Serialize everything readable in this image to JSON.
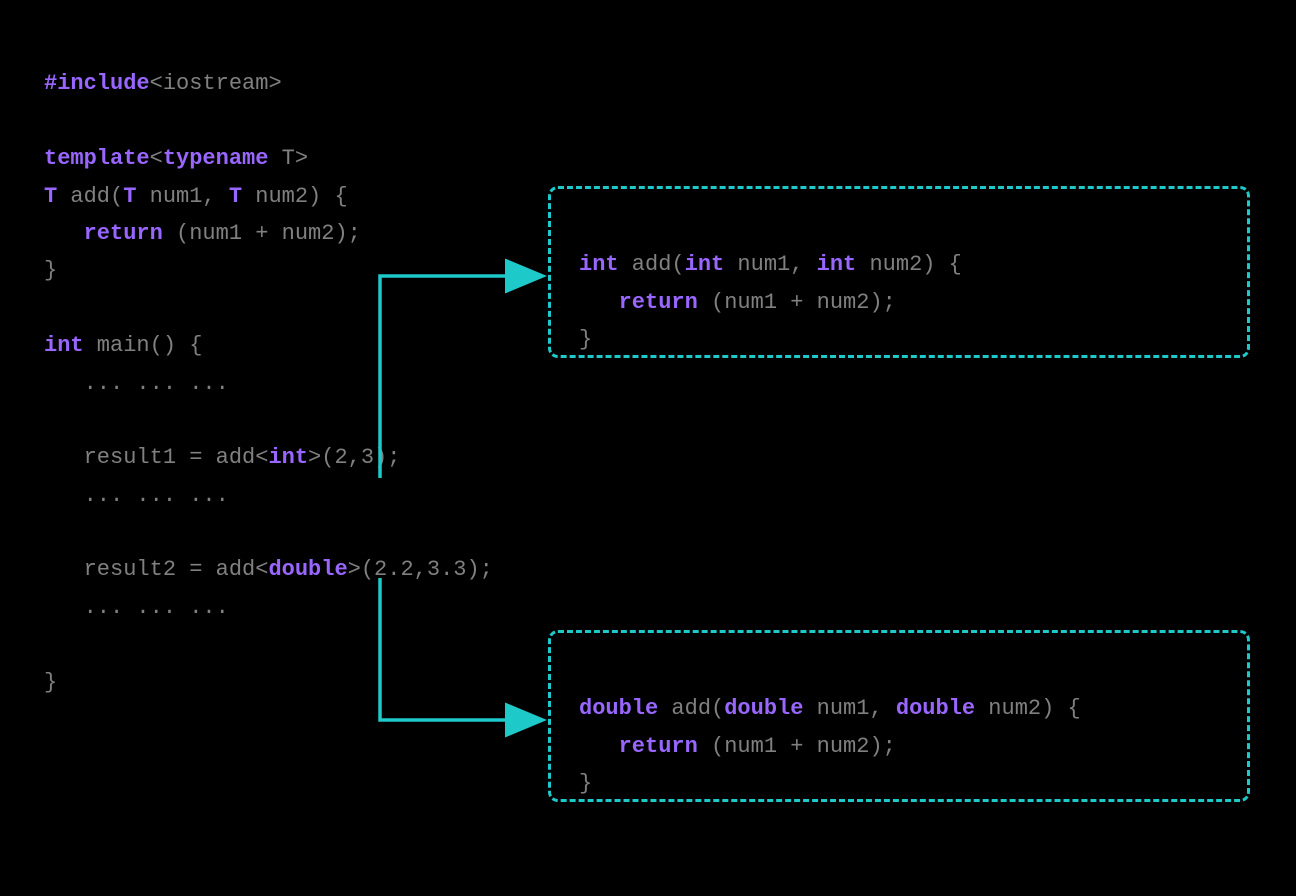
{
  "colors": {
    "keyword": "#9966ff",
    "text": "#808080",
    "border": "#1ec9c9",
    "arrow": "#1ec9c9",
    "background": "#000000"
  },
  "main_code": {
    "l1a": "#include",
    "l1b": "<iostream>",
    "l3a": "template",
    "l3b": "<",
    "l3c": "typename",
    "l3d": " T>",
    "l4a": "T",
    "l4b": " add(",
    "l4c": "T",
    "l4d": " num1, ",
    "l4e": "T",
    "l4f": " num2) {",
    "l5a": "   ",
    "l5b": "return",
    "l5c": " (num1 + num2);",
    "l6": "}",
    "l8a": "int",
    "l8b": " main() {",
    "l9": "   ... ... ...",
    "l11a": "   result1 = add<",
    "l11b": "int",
    "l11c": ">(2,3);",
    "l12": "   ... ... ...",
    "l14a": "   result2 = add<",
    "l14b": "double",
    "l14c": ">(2.2,3.3);",
    "l15": "   ... ... ...",
    "l17": "}"
  },
  "box_int": {
    "l1a": "int",
    "l1b": " add(",
    "l1c": "int",
    "l1d": " num1, ",
    "l1e": "int",
    "l1f": " num2) {",
    "l2a": "   ",
    "l2b": "return",
    "l2c": " (num1 + num2);",
    "l3": "}"
  },
  "box_double": {
    "l1a": "double",
    "l1b": " add(",
    "l1c": "double",
    "l1d": " num1, ",
    "l1e": "double",
    "l1f": " num2) {",
    "l2a": "   ",
    "l2b": "return",
    "l2c": " (num1 + num2);",
    "l3": "}"
  }
}
